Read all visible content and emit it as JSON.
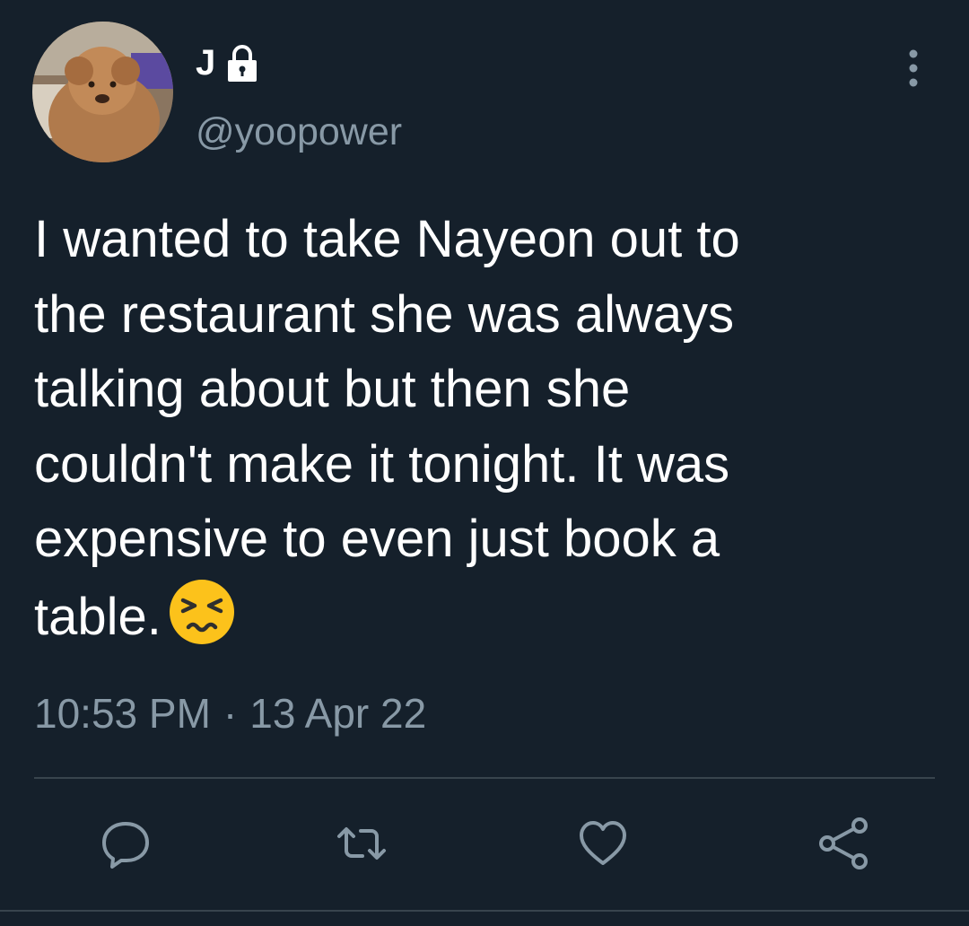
{
  "author": {
    "display_name": "J",
    "handle": "@yoopower",
    "protected_icon": "lock-icon",
    "avatar": "avatar-icon"
  },
  "menu": {
    "icon": "more-vertical-icon"
  },
  "tweet": {
    "text": "I wanted to take Nayeon out to\nthe restaurant she was always\ntalking about but then she\ncouldn't make it tonight. It was\nexpensive to even just book a\ntable.",
    "emoji": "persevering-face-emoji"
  },
  "meta": {
    "time": "10:53 PM",
    "separator": "·",
    "date": "13 Apr 22"
  },
  "actions": [
    {
      "name": "reply",
      "icon": "reply-icon"
    },
    {
      "name": "retweet",
      "icon": "retweet-icon"
    },
    {
      "name": "like",
      "icon": "heart-icon"
    },
    {
      "name": "share",
      "icon": "share-icon"
    }
  ],
  "colors": {
    "background": "#15202b",
    "text_primary": "#ffffff",
    "text_secondary": "#8899a6",
    "divider": "#38444d"
  }
}
